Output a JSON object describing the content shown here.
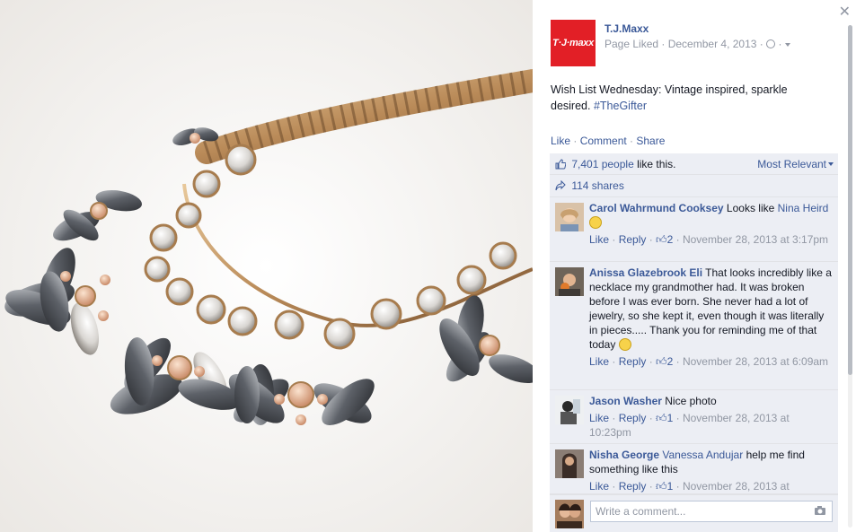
{
  "page": {
    "name": "T.J.Maxx",
    "logo_text": "T·J·maxx",
    "status": "Page Liked",
    "date": "December 4, 2013",
    "globe_icon": "globe-icon",
    "caret_icon": "caret-icon"
  },
  "post": {
    "text": "Wish List Wednesday: Vintage inspired, sparkle desired.",
    "hashtag": "#TheGifter"
  },
  "actions": {
    "like": "Like",
    "comment": "Comment",
    "share": "Share"
  },
  "reactions": {
    "likes_link": "7,401 people",
    "likes_suffix": "like this.",
    "sort": "Most Relevant",
    "shares": "114 shares"
  },
  "comments": [
    {
      "author": "Carol Wahrmund Cooksey",
      "text": "Looks like",
      "tag": "Nina Heird",
      "emoji": "grin",
      "like": "Like",
      "reply": "Reply",
      "likes": "2",
      "time": "November 28, 2013 at 3:17pm"
    },
    {
      "author": "Anissa Glazebrook Eli",
      "text": "That looks incredibly like a necklace my grandmother had. It was broken before I was ever born. She never had a lot of jewelry, so she kept it, even though it was literally in pieces..... Thank you for reminding me of that today",
      "emoji": "smile",
      "like": "Like",
      "reply": "Reply",
      "likes": "2",
      "time": "November 28, 2013 at 6:09am"
    },
    {
      "author": "Jason Washer",
      "text": "Nice photo",
      "like": "Like",
      "reply": "Reply",
      "likes": "1",
      "time": "November 28, 2013 at 10:23pm"
    },
    {
      "author": "Nisha George",
      "tag": "Vanessa Andujar",
      "text": "help me find something like this",
      "like": "Like",
      "reply": "Reply",
      "likes": "1",
      "time": "November 28, 2013 at"
    }
  ],
  "composer": {
    "placeholder": "Write a comment...",
    "camera_icon": "camera-icon"
  },
  "close_icon": "close-icon",
  "colors": {
    "brand": "#e21f26",
    "link": "#3b5998",
    "muted": "#9197a3",
    "ufi_bg": "#eceef4"
  }
}
